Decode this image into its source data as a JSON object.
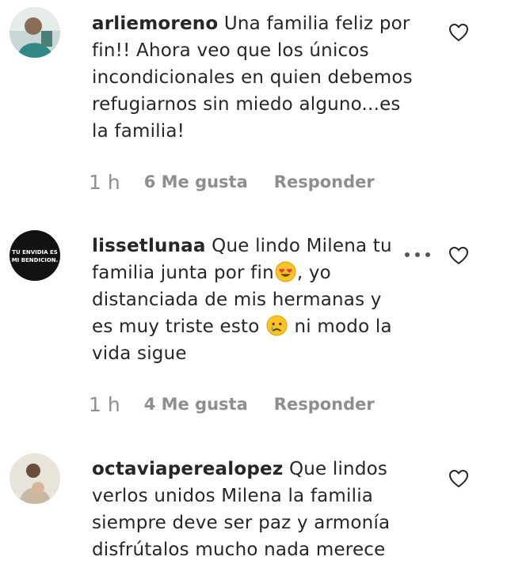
{
  "comments": [
    {
      "username": "arliemoreno",
      "text": "Una familia feliz por fin!! Ahora veo que los únicos incondicionales en quien debemos refugiarnos sin miedo alguno...es la familia!",
      "time": "1 h",
      "likes": "6 Me gusta",
      "reply": "Responder"
    },
    {
      "username": "lissetlunaa",
      "text_1": "Que lindo Milena tu familia junta por fin",
      "emoji_1": "heart-eyes-emoji",
      "text_2": ", yo distanciada de mis hermanas y es muy triste esto",
      "emoji_2": "crying-face-emoji",
      "text_3": "ni modo la vida sigue",
      "avatar_text": [
        "TU ENVIDIA ES",
        "MI BENDICION."
      ],
      "time": "1 h",
      "likes": "4 Me gusta",
      "reply": "Responder"
    },
    {
      "username": "octaviaperealopez",
      "text": "Que lindos verlos unidos Milena la familia siempre deve ser paz y armonía disfrútalos mucho nada merece"
    }
  ],
  "colors": {
    "text": "#262626",
    "secondary": "#8e8e8e",
    "emoji_yellow": "#f7c325",
    "emoji_heart": "#e8344a",
    "tear_blue": "#5aa9e6"
  }
}
